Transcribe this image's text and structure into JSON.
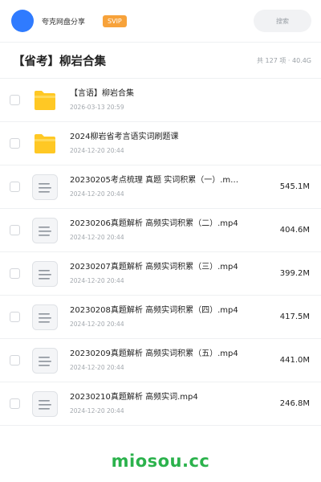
{
  "header": {
    "brand": "夸克网盘分享",
    "badge": "SVIP",
    "search_label": "搜索"
  },
  "folder": {
    "title": "【省考】柳岩合集",
    "summary": "共 127 项 · 40.4G"
  },
  "items": [
    {
      "type": "folder",
      "name": "【言语】柳岩合集",
      "date": "2026-03-13 20:59",
      "size": ""
    },
    {
      "type": "folder",
      "name": "2024柳岩省考言语实词刷题课",
      "date": "2024-12-20 20:44",
      "size": ""
    },
    {
      "type": "file",
      "name": "20230205考点梳理 真题 实词积累（一）.m…",
      "date": "2024-12-20 20:44",
      "size": "545.1M"
    },
    {
      "type": "file",
      "name": "20230206真题解析 高频实词积累（二）.mp4",
      "date": "2024-12-20 20:44",
      "size": "404.6M"
    },
    {
      "type": "file",
      "name": "20230207真题解析 高频实词积累（三）.mp4",
      "date": "2024-12-20 20:44",
      "size": "399.2M"
    },
    {
      "type": "file",
      "name": "20230208真题解析 高频实词积累（四）.mp4",
      "date": "2024-12-20 20:44",
      "size": "417.5M"
    },
    {
      "type": "file",
      "name": "20230209真题解析 高频实词积累（五）.mp4",
      "date": "2024-12-20 20:44",
      "size": "441.0M"
    },
    {
      "type": "file",
      "name": "20230210真题解析 高频实词.mp4",
      "date": "2024-12-20 20:44",
      "size": "246.8M"
    }
  ],
  "icons": {
    "folder": "folder-icon",
    "file": "document-icon"
  },
  "colors": {
    "accent": "#2f7bff",
    "folder": "#ffc824",
    "badge": "#f7a23a",
    "watermark": "#2bb24c"
  },
  "watermark": "miosou.cc"
}
